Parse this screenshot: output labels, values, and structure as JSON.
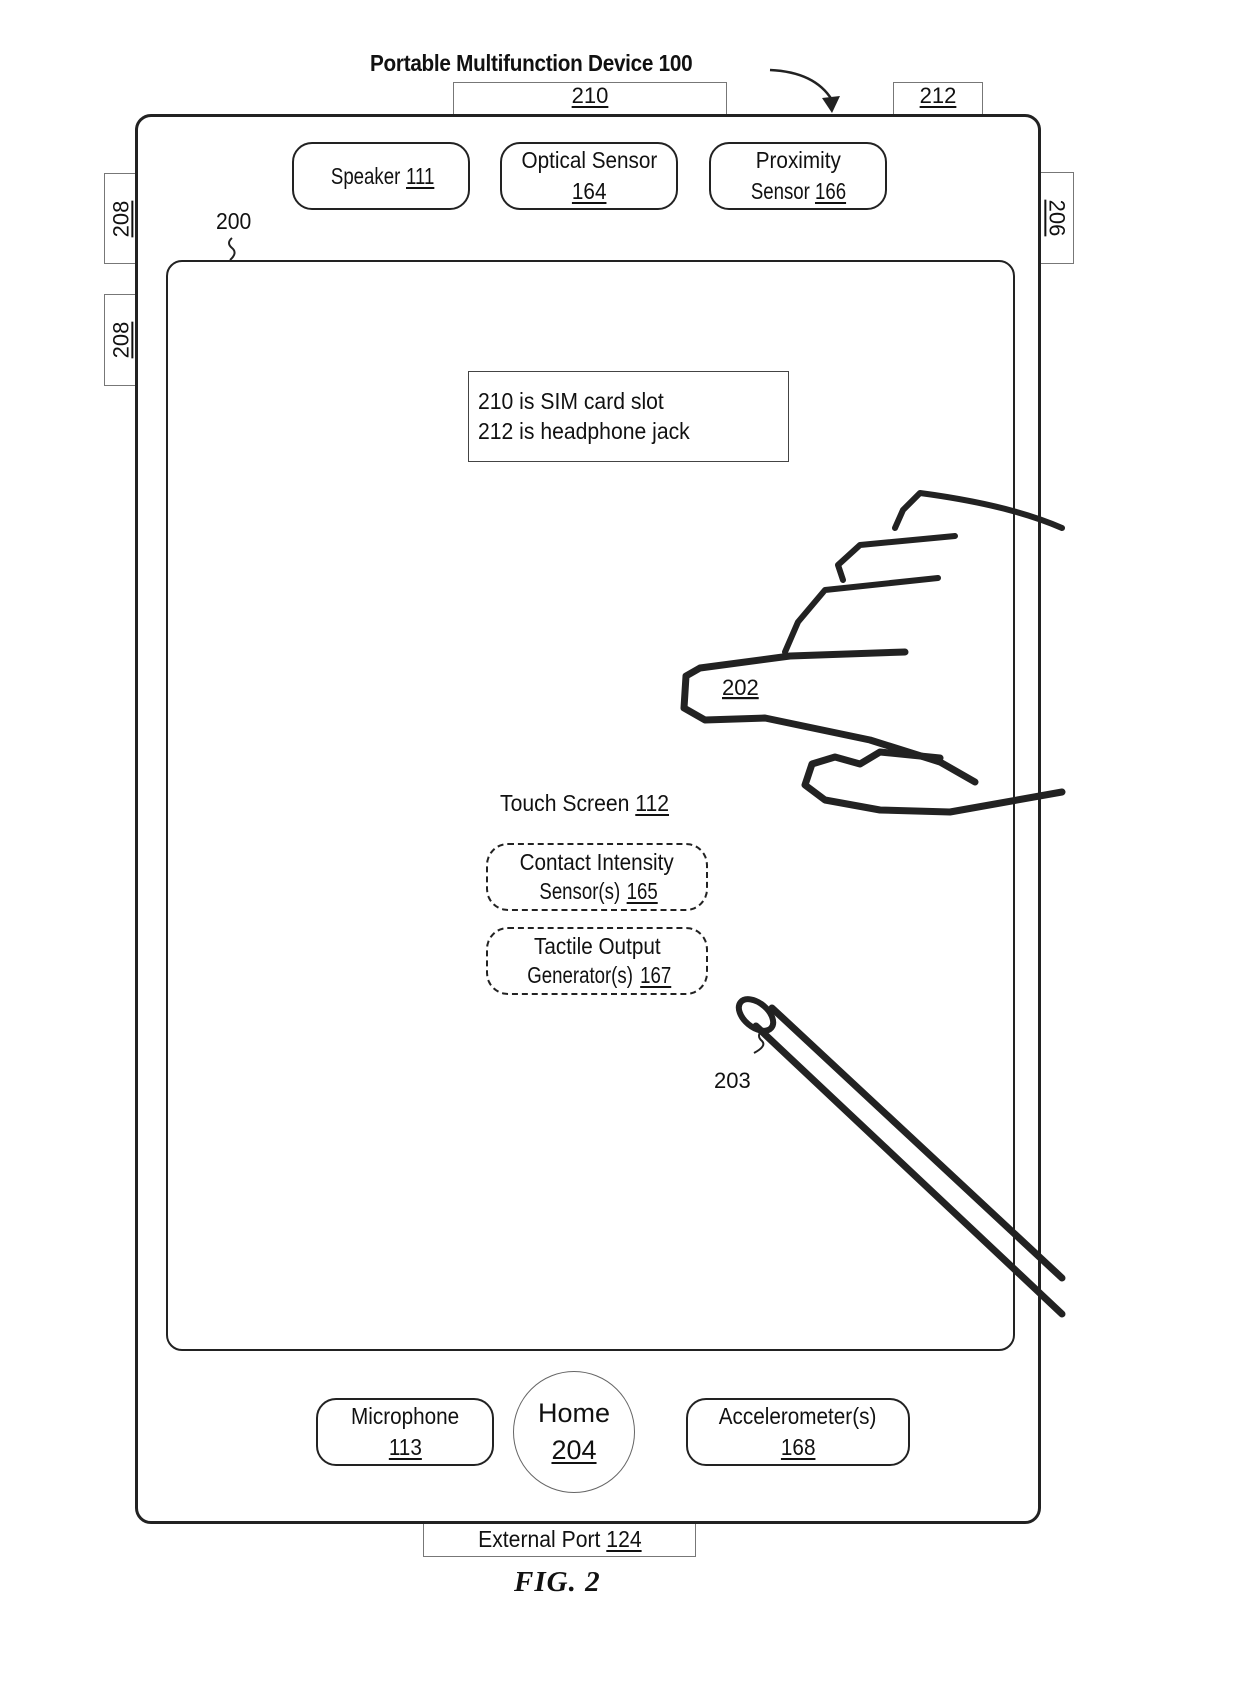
{
  "figure": {
    "title": "Portable Multifunction Device 100",
    "caption": "FIG. 2"
  },
  "device": {
    "ref": "100",
    "screen_ref": "200",
    "ports": {
      "sim_slot": "210",
      "headphone_jack": "212",
      "side_button_upper": "208",
      "side_button_lower": "208",
      "push_button": "206",
      "external_port": {
        "text": "External Port ",
        "ref": "124"
      }
    },
    "top_components": [
      {
        "line1": "Speaker ",
        "ref": "111",
        "inline": true
      },
      {
        "line1": "Optical Sensor",
        "ref": "164",
        "inline": false
      },
      {
        "line1": "Proximity",
        "line2": "Sensor ",
        "ref": "166",
        "inline": true
      }
    ],
    "bottom_components": [
      {
        "line1": "Microphone",
        "ref": "113"
      },
      {
        "line1": "Home",
        "ref": "204"
      },
      {
        "line1": "Accelerometer(s)",
        "ref": "168"
      }
    ]
  },
  "note": {
    "line1": "210 is SIM card slot",
    "line2": "212 is headphone jack"
  },
  "touch_screen": {
    "label": "Touch Screen ",
    "ref": "112",
    "contact_sensor": {
      "line1": "Contact Intensity",
      "line2": "Sensor(s) ",
      "ref": "165"
    },
    "tactile_generator": {
      "line1": "Tactile Output",
      "line2": "Generator(s) ",
      "ref": "167"
    }
  },
  "finger": {
    "ref": "202"
  },
  "stylus": {
    "ref": "203"
  }
}
